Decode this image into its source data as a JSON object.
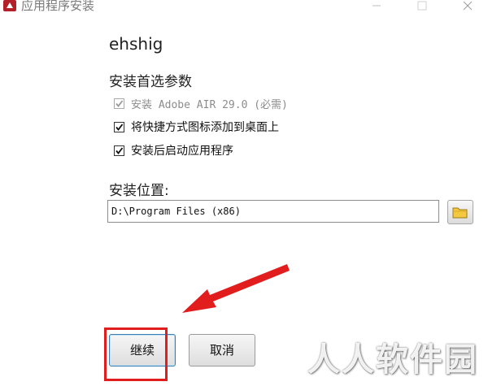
{
  "window": {
    "title": "应用程序安装"
  },
  "installer": {
    "app_name": "ehshig",
    "preferences_title": "安装首选参数",
    "options": [
      {
        "label": "安装 Adobe AIR 29.0 (必需)",
        "checked": true,
        "disabled": true
      },
      {
        "label": "将快捷方式图标添加到桌面上",
        "checked": true,
        "disabled": false
      },
      {
        "label": "安装后启动应用程序",
        "checked": true,
        "disabled": false
      }
    ],
    "location_label": "安装位置:",
    "install_path": "D:\\Program Files (x86)"
  },
  "buttons": {
    "continue": "继续",
    "cancel": "取消"
  },
  "watermark": "人人软件园",
  "colors": {
    "annotation": "#e11d1d",
    "focus_border": "#3c7fb1"
  }
}
